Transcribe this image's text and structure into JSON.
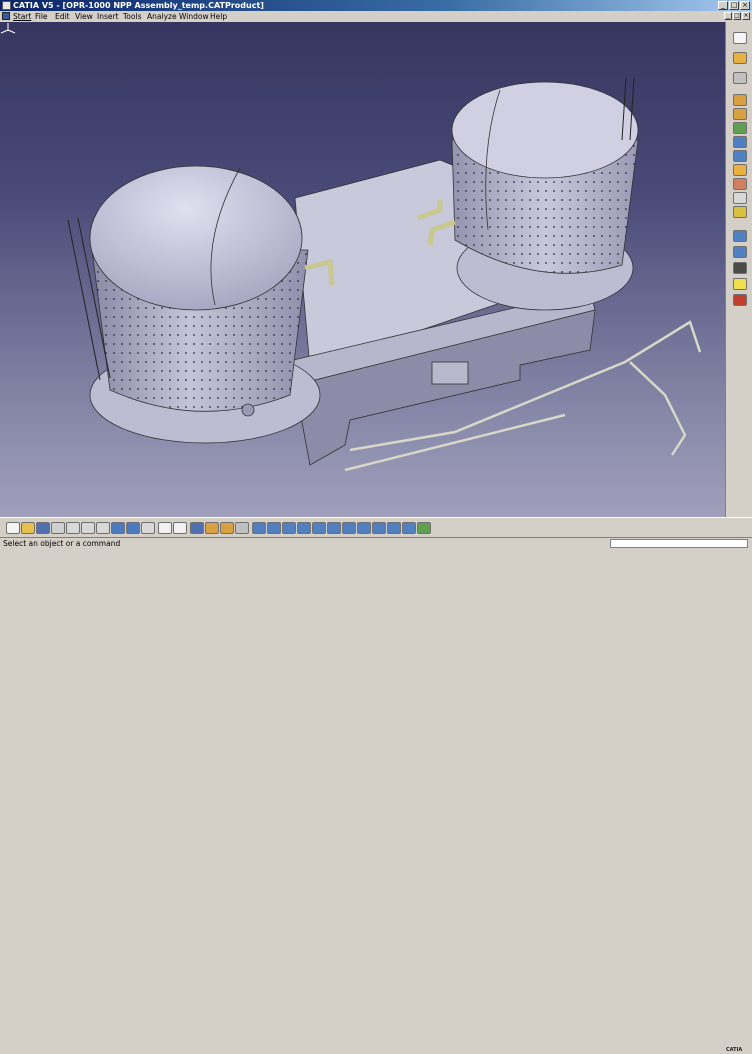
{
  "window": {
    "title": "CATIA V5 - [OPR-1000 NPP Assembly_temp.CATProduct]",
    "controls": [
      "_",
      "□",
      "×"
    ]
  },
  "menubar": {
    "items": [
      "Start",
      "File",
      "Edit",
      "View",
      "Insert",
      "Tools",
      "Analyze",
      "Window",
      "Help"
    ]
  },
  "viewport": {
    "model": "OPR-1000 NPP Assembly_temp.CATProduct",
    "background_top": "#363660",
    "background_bottom": "#a0a0bc",
    "compass_icon": "compass-axis-icon"
  },
  "right_toolbar": {
    "icons": [
      "select-icon",
      "sketch-icon",
      "rotate-icon",
      "part-icon",
      "product-icon",
      "constraint-icon",
      "measure-icon",
      "manipulate-icon",
      "snap-icon",
      "catalog-icon",
      "scene-icon",
      "explode-icon",
      "clash-icon",
      "section-icon",
      "annotation-icon",
      "lightbulb-icon",
      "delete-icon"
    ]
  },
  "bottom_toolbar": {
    "icons": [
      "new-icon",
      "open-icon",
      "save-icon",
      "print-icon",
      "cut-icon",
      "copy-icon",
      "paste-icon",
      "undo-icon",
      "redo-icon",
      "help-icon",
      "formula-icon",
      "comment-icon",
      "catalog-icon",
      "sketch-icon",
      "product-icon",
      "knowledge-icon",
      "fly-icon",
      "fit-all-icon",
      "pan-icon",
      "rotate-view-icon",
      "zoom-in-icon",
      "zoom-out-icon",
      "normal-view-icon",
      "iso-view-icon",
      "render-style-icon",
      "hide-show-icon",
      "swap-icon",
      "apply-material-icon"
    ],
    "brand": "CATIA"
  },
  "status": {
    "message": "Select an object or a command"
  }
}
